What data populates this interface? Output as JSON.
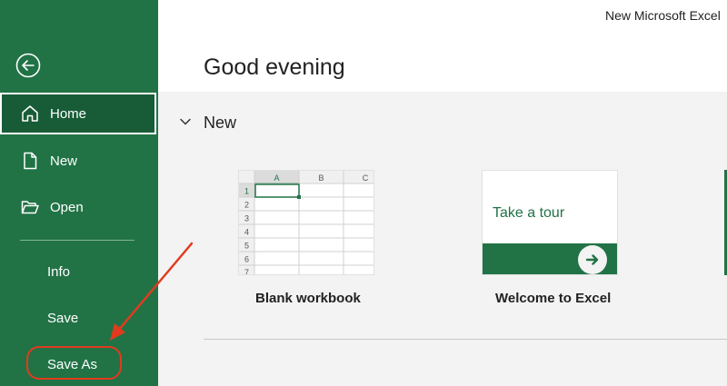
{
  "window": {
    "title": "New Microsoft Excel"
  },
  "sidebar": {
    "items": [
      {
        "label": "Home",
        "icon": "home-icon"
      },
      {
        "label": "New",
        "icon": "new-document-icon"
      },
      {
        "label": "Open",
        "icon": "folder-open-icon"
      },
      {
        "label": "Info"
      },
      {
        "label": "Save"
      },
      {
        "label": "Save As"
      }
    ]
  },
  "main": {
    "greeting": "Good evening",
    "section_title": "New",
    "templates": [
      {
        "label": "Blank workbook"
      },
      {
        "label": "Welcome to Excel",
        "thumb_text": "Take a tour"
      }
    ],
    "grid": {
      "columns": [
        "A",
        "B",
        "C"
      ],
      "rows": [
        "1",
        "2",
        "3",
        "4",
        "5",
        "6",
        "7"
      ]
    }
  },
  "colors": {
    "brand": "#217346",
    "brand_dark": "#185c37",
    "annotation": "#e23a1e"
  }
}
